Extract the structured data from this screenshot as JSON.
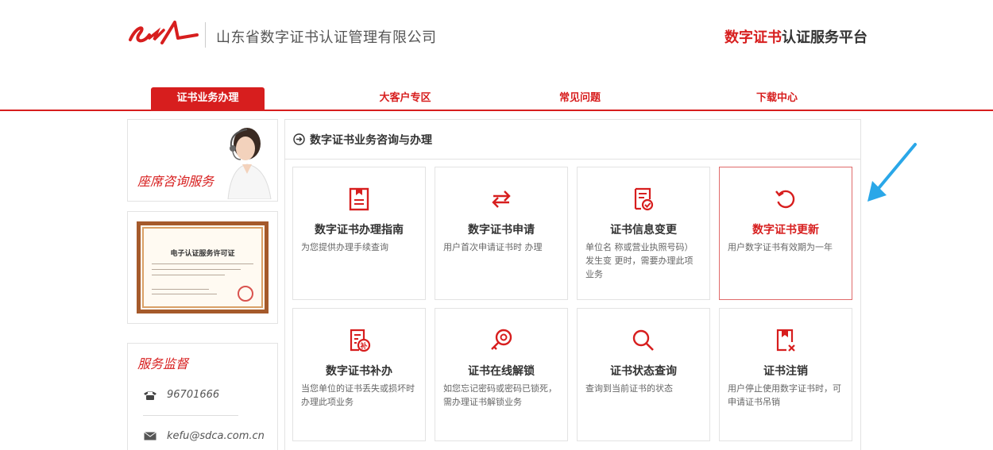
{
  "header": {
    "company": "山东省数字证书认证管理有限公司",
    "platform_red": "数字证书",
    "platform_rest": "认证服务平台"
  },
  "nav": {
    "items": [
      {
        "label": "证书业务办理",
        "active": true
      },
      {
        "label": "大客户专区",
        "active": false
      },
      {
        "label": "常见问题",
        "active": false
      },
      {
        "label": "下载中心",
        "active": false
      }
    ]
  },
  "sidebar": {
    "seat_label": "座席咨询服务",
    "license_title": "电子认证服务许可证",
    "supervise_title": "服务监督",
    "phone": "96701666",
    "email": "kefu@sdca.com.cn"
  },
  "main": {
    "title": "数字证书业务咨询与办理",
    "cards": [
      {
        "icon": "document-guide-icon",
        "title": "数字证书办理指南",
        "desc": "为您提供办理手续查询"
      },
      {
        "icon": "exchange-arrows-icon",
        "title": "数字证书申请",
        "desc": "用户首次申请证书时 办理"
      },
      {
        "icon": "file-check-icon",
        "title": "证书信息变更",
        "desc": "单位名 称或营业执照号码）发生变 更时，需要办理此项业务"
      },
      {
        "icon": "refresh-icon",
        "title": "数字证书更新",
        "desc": "用户数字证书有效期为一年"
      },
      {
        "icon": "file-supplement-icon",
        "title": "数字证书补办",
        "desc": "当您单位的证书丢失或损坏时办理此项业务"
      },
      {
        "icon": "key-unlock-icon",
        "title": "证书在线解锁",
        "desc": "如您忘记密码或密码已锁死，需办理证书解锁业务"
      },
      {
        "icon": "magnifier-icon",
        "title": "证书状态查询",
        "desc": "查询到当前证书的状态"
      },
      {
        "icon": "certificate-cancel-icon",
        "title": "证书注销",
        "desc": "用户停止使用数字证书时，可申请证书吊销"
      }
    ]
  },
  "colors": {
    "brand_red": "#d71e1e",
    "arrow_blue": "#2aa7e8"
  }
}
